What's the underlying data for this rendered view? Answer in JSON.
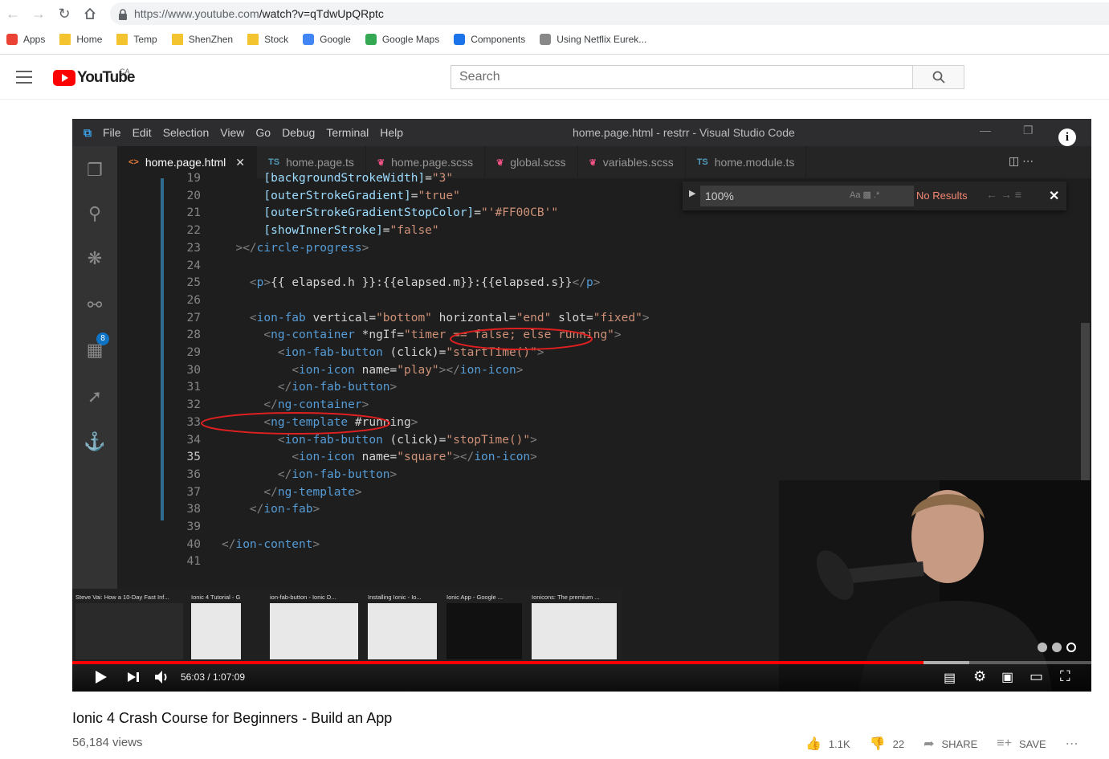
{
  "browser": {
    "url_host": "https://www.youtube.com",
    "url_path": "/watch?v=qTdwUpQRptc",
    "bookmarks": [
      {
        "label": "Apps",
        "icon": "apps-grid-icon"
      },
      {
        "label": "Home",
        "icon": "folder-icon"
      },
      {
        "label": "Temp",
        "icon": "folder-icon"
      },
      {
        "label": "ShenZhen",
        "icon": "folder-icon"
      },
      {
        "label": "Stock",
        "icon": "folder-icon"
      },
      {
        "label": "Google",
        "icon": "google-icon"
      },
      {
        "label": "Google Maps",
        "icon": "google-maps-icon"
      },
      {
        "label": "Components",
        "icon": "puzzle-icon"
      },
      {
        "label": "Using Netflix Eurek...",
        "icon": "globe-icon"
      }
    ]
  },
  "youtube": {
    "logo_text": "YouTube",
    "country": "CA",
    "search_placeholder": "Search"
  },
  "video": {
    "vscode": {
      "menu": [
        "File",
        "Edit",
        "Selection",
        "View",
        "Go",
        "Debug",
        "Terminal",
        "Help"
      ],
      "window_title": "home.page.html - restrr - Visual Studio Code",
      "tabs": [
        {
          "label": "home.page.html",
          "icon": "<>",
          "active": true
        },
        {
          "label": "home.page.ts",
          "icon": "TS"
        },
        {
          "label": "home.page.scss",
          "icon": "scss"
        },
        {
          "label": "global.scss",
          "icon": "scss"
        },
        {
          "label": "variables.scss",
          "icon": "scss"
        },
        {
          "label": "home.module.ts",
          "icon": "TS"
        }
      ],
      "find": {
        "value": "100%",
        "result": "No Results"
      },
      "scm_badge": "8",
      "lines": [
        {
          "n": "19",
          "indent": "      ",
          "html": "[backgroundStrokeWidth]=\"3\""
        },
        {
          "n": "20",
          "indent": "      ",
          "html": "[outerStrokeGradient]=\"true\""
        },
        {
          "n": "21",
          "indent": "      ",
          "html": "[outerStrokeGradientStopColor]=\"'#FF00CB'\""
        },
        {
          "n": "22",
          "indent": "      ",
          "html": "[showInnerStroke]=\"false\""
        },
        {
          "n": "23",
          "indent": "  ",
          "html": "></circle-progress>"
        },
        {
          "n": "24",
          "indent": "",
          "html": ""
        },
        {
          "n": "25",
          "indent": "    ",
          "html": "<p>{{ elapsed.h }}:{{elapsed.m}}:{{elapsed.s}}</p>"
        },
        {
          "n": "26",
          "indent": "",
          "html": ""
        },
        {
          "n": "27",
          "indent": "    ",
          "html": "<ion-fab vertical=\"bottom\" horizontal=\"end\" slot=\"fixed\">"
        },
        {
          "n": "28",
          "indent": "      ",
          "html": "<ng-container *ngIf=\"timer == false; else running\">"
        },
        {
          "n": "29",
          "indent": "        ",
          "html": "<ion-fab-button (click)=\"startTime()\">"
        },
        {
          "n": "30",
          "indent": "          ",
          "html": "<ion-icon name=\"play\"></ion-icon>"
        },
        {
          "n": "31",
          "indent": "        ",
          "html": "</ion-fab-button>"
        },
        {
          "n": "32",
          "indent": "      ",
          "html": "</ng-container>"
        },
        {
          "n": "33",
          "indent": "      ",
          "html": "<ng-template #running>"
        },
        {
          "n": "34",
          "indent": "        ",
          "html": "<ion-fab-button (click)=\"stopTime()\">"
        },
        {
          "n": "35",
          "indent": "          ",
          "html": "<ion-icon name=\"square\"></ion-icon>"
        },
        {
          "n": "36",
          "indent": "        ",
          "html": "</ion-fab-button>"
        },
        {
          "n": "37",
          "indent": "      ",
          "html": "</ng-template>"
        },
        {
          "n": "38",
          "indent": "    ",
          "html": "</ion-fab>"
        },
        {
          "n": "39",
          "indent": "",
          "html": ""
        },
        {
          "n": "40",
          "indent": "",
          "html": "</ion-content>"
        },
        {
          "n": "41",
          "indent": "",
          "html": ""
        }
      ]
    },
    "related": [
      "Steve Vai: How a 10-Day Fast Inf...",
      "Ionic 4 Tutorial - G...",
      "ion-fab-button - Ionic D...",
      "Installing Ionic - Io...",
      "Ionic App - Google ...",
      "Ionicons: The premium ..."
    ],
    "player": {
      "time": "56:03 / 1:07:09",
      "progress": 0.835,
      "buffered": 0.88
    }
  },
  "meta": {
    "title": "Ionic 4 Crash Course for Beginners - Build an App",
    "views": "56,184 views",
    "likes": "1.1K",
    "dislikes": "22",
    "share": "SHARE",
    "save": "SAVE"
  }
}
